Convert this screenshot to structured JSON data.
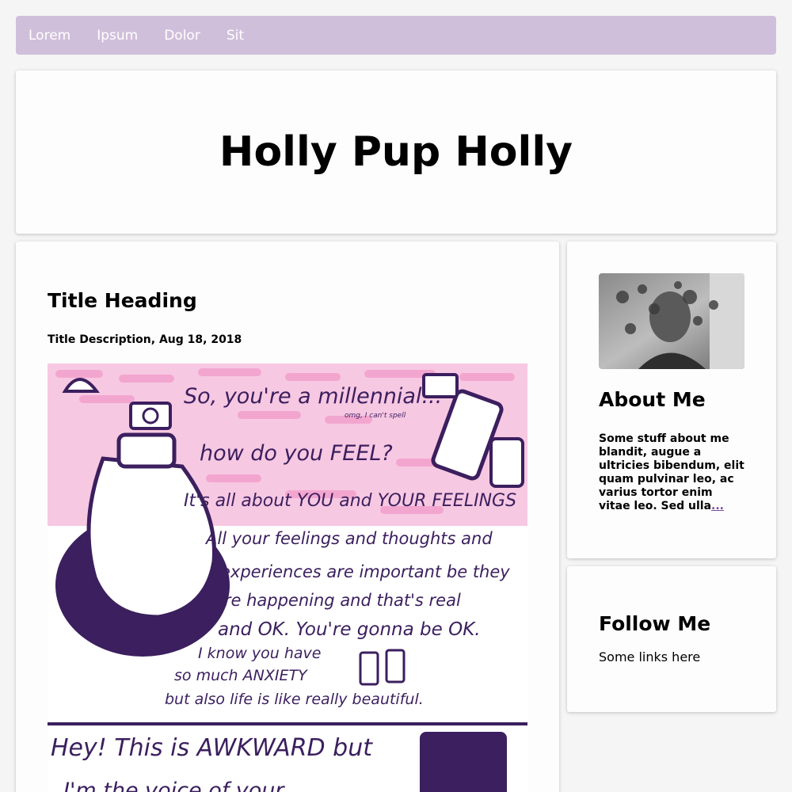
{
  "nav": {
    "items": [
      {
        "label": "Lorem"
      },
      {
        "label": "Ipsum"
      },
      {
        "label": "Dolor"
      },
      {
        "label": "Sit"
      }
    ]
  },
  "header": {
    "title": "Holly Pup Holly"
  },
  "main": {
    "title": "Title Heading",
    "description": "Title Description, Aug 18, 2018",
    "art_text": {
      "line1": "So, you're a millennial...",
      "note": "omg, I can't spell",
      "line2": "how do you FEEL?",
      "line3": "It's all about YOU and YOUR FEELINGS",
      "line4": "All your feelings and thoughts and",
      "line5": "experiences are important be they",
      "line6": "are happening and that's real",
      "line7": "and OK. You're gonna be OK.",
      "line8": "I know you have",
      "line9": "so much ANXIETY",
      "line10": "but also life is like really beautiful.",
      "line11": "Hey! This is AWKWARD but",
      "line12": "I'm the voice of your"
    },
    "colors": {
      "ink": "#3b1f5e",
      "pink": "#f2a6cf"
    }
  },
  "about": {
    "title": "About Me",
    "text": "Some stuff about me blandit, augue a ultricies bibendum, elit quam pulvinar leo, ac varius tortor enim vitae leo. Sed ulla",
    "more": "..."
  },
  "follow": {
    "title": "Follow Me",
    "text": "Some links here"
  }
}
